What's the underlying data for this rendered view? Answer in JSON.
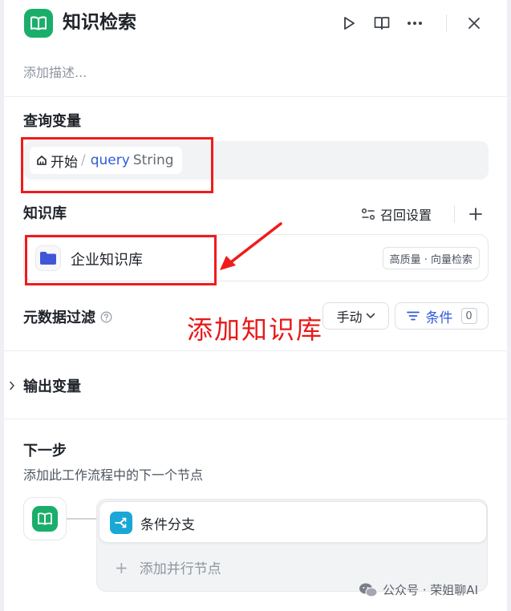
{
  "header": {
    "title": "知识检索",
    "description_placeholder": "添加描述..."
  },
  "query_variable": {
    "section_title": "查询变量",
    "source": "开始",
    "separator": "/",
    "variable": "query",
    "type": "String"
  },
  "knowledge_base": {
    "section_title": "知识库",
    "recall_settings_label": "召回设置",
    "items": [
      {
        "name": "企业知识库",
        "tag": "高质量 · 向量检索"
      }
    ]
  },
  "metadata_filter": {
    "section_title": "元数据过滤",
    "mode_value": "手动",
    "condition_label": "条件",
    "condition_count": "0"
  },
  "output": {
    "section_title": "输出变量"
  },
  "next_step": {
    "section_title": "下一步",
    "description": "添加此工作流程中的下一个节点",
    "next_node_label": "条件分支",
    "add_parallel_label": "添加并行节点"
  },
  "annotation": {
    "text": "添加知识库"
  },
  "watermark": {
    "text": "公众号 · 荣姐聊AI"
  },
  "colors": {
    "node_green": "#1bae6b",
    "link_blue": "#2e5bd9",
    "branch_cyan": "#1aa7d6",
    "annotation_red": "#f01b1b"
  }
}
